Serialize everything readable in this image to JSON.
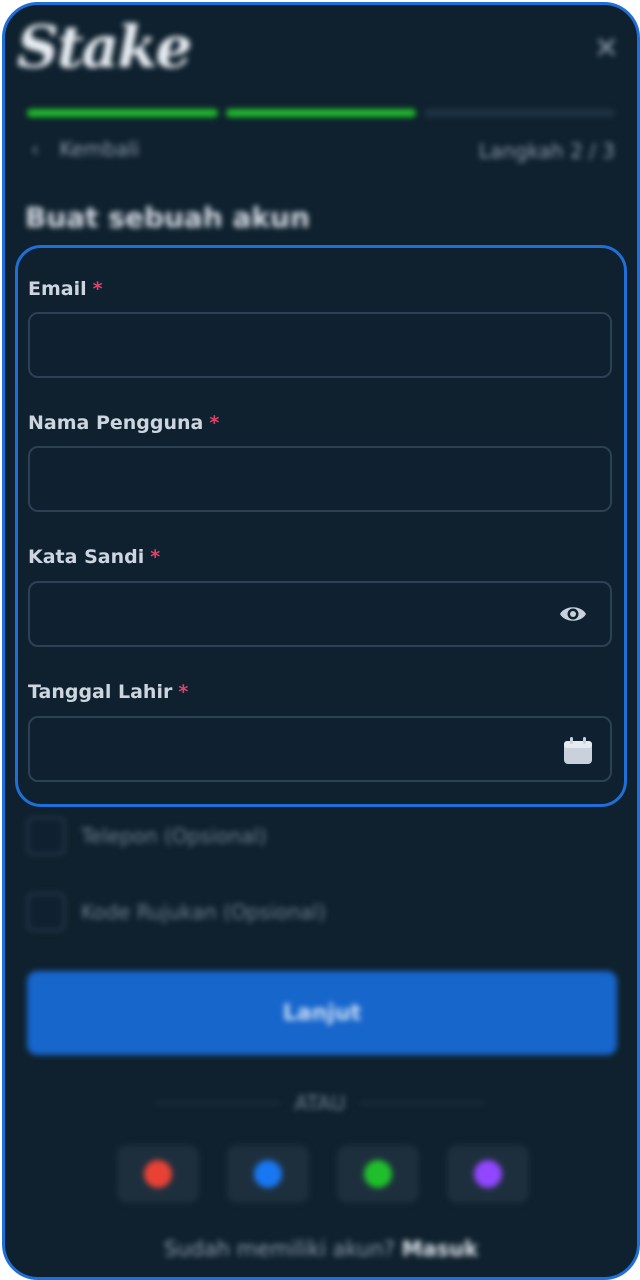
{
  "header": {
    "logo_text": "Stake",
    "close_symbol": "✕"
  },
  "nav": {
    "back_symbol": "‹",
    "back_label": "Kembali",
    "step_text": "Langkah 2 / 3"
  },
  "progress": {
    "completed_steps": 2,
    "total_steps": 3
  },
  "page": {
    "title": "Buat sebuah akun"
  },
  "form": {
    "required_mark": "*",
    "email": {
      "label": "Email",
      "value": ""
    },
    "username": {
      "label": "Nama Pengguna",
      "value": ""
    },
    "password": {
      "label": "Kata Sandi",
      "value": ""
    },
    "birthdate": {
      "label": "Tanggal Lahir",
      "value": ""
    }
  },
  "options": {
    "phone_label": "Telepon (Opsional)",
    "referral_label": "Kode Rujukan (Opsional)"
  },
  "actions": {
    "continue_label": "Lanjut",
    "or_label": "ATAU"
  },
  "social": [
    {
      "name": "google-icon",
      "color": "#e94235"
    },
    {
      "name": "facebook-icon",
      "color": "#1877f2"
    },
    {
      "name": "line-icon",
      "color": "#1fbf2b"
    },
    {
      "name": "twitch-icon",
      "color": "#9146ff"
    }
  ],
  "footer": {
    "prompt": "Sudah memiliki akun?",
    "signin_label": "Masuk"
  },
  "colors": {
    "background": "#0f212e",
    "accent_blue": "#1f6fd8",
    "progress_green": "#1fbf2b",
    "required_red": "#e0426b"
  }
}
